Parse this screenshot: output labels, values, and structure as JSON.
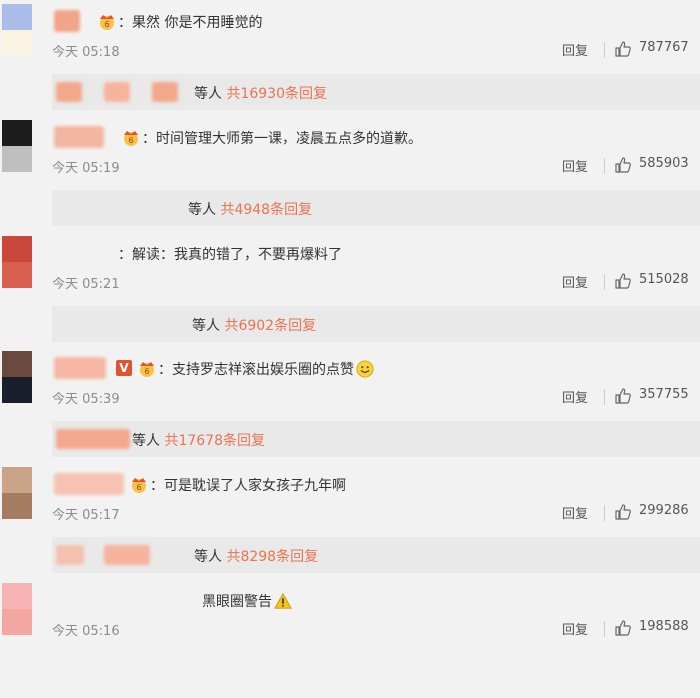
{
  "comments": [
    {
      "text": "：果然 你是不用睡觉的",
      "time": "今天 05:18",
      "reply": "回复",
      "likes": "787767",
      "thread_prefix": "等人",
      "thread_count": "共16930条回复"
    },
    {
      "text": "：时间管理大师第一课，凌晨五点多的道歉。",
      "time": "今天 05:19",
      "reply": "回复",
      "likes": "585903",
      "thread_prefix": "等人",
      "thread_count": "共4948条回复"
    },
    {
      "text": "：解读：我真的错了，不要再爆料了",
      "time": "今天 05:21",
      "reply": "回复",
      "likes": "515028",
      "thread_prefix": "等人",
      "thread_count": "共6902条回复"
    },
    {
      "text": "：支持罗志祥滚出娱乐圈的点赞",
      "time": "今天 05:39",
      "reply": "回复",
      "likes": "357755",
      "thread_prefix": "等人",
      "thread_count": "共17678条回复"
    },
    {
      "text": "：可是耽误了人家女孩子九年啊",
      "time": "今天 05:17",
      "reply": "回复",
      "likes": "299286",
      "thread_prefix": "等人",
      "thread_count": "共8298条回复"
    },
    {
      "text": "黑眼圈警告",
      "time": "今天 05:16",
      "reply": "回复",
      "likes": "198588"
    }
  ],
  "vip_badge": "V",
  "colors": {
    "accent": "#eb7350",
    "background": "#f2f2f2",
    "thread_bar": "#e9e9e9"
  },
  "icons": [
    "crown-badge-icon",
    "vip-badge-icon",
    "thumbs-up-icon",
    "smiley-emoji-icon",
    "warning-emoji-icon"
  ]
}
